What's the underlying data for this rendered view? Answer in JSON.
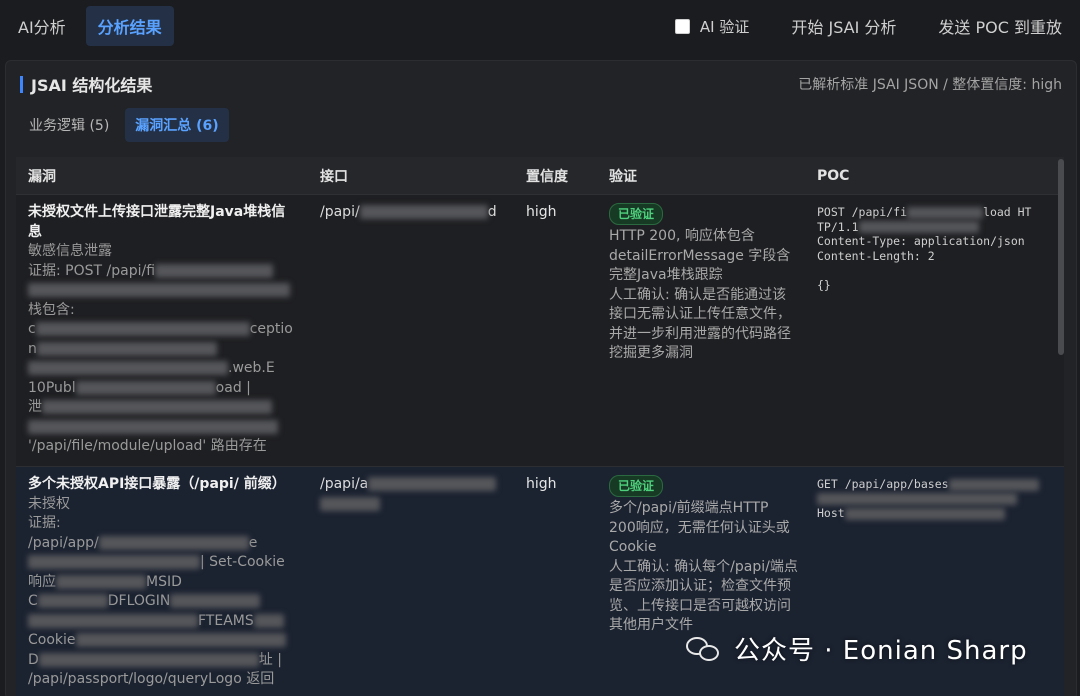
{
  "topbar": {
    "tabs": [
      {
        "label": "AI分析",
        "active": false
      },
      {
        "label": "分析结果",
        "active": true
      }
    ],
    "ai_verify_label": "AI 验证",
    "ai_verify_checked": false,
    "start_label": "开始 JSAI 分析",
    "send_poc_label": "发送 POC 到重放"
  },
  "panel": {
    "title": "JSAI 结构化结果",
    "meta": "已解析标准 JSAI JSON / 整体置信度: high",
    "subtabs": [
      {
        "label": "业务逻辑 (5)",
        "active": false
      },
      {
        "label": "漏洞汇总 (6)",
        "active": true
      }
    ]
  },
  "table": {
    "headers": [
      "漏洞",
      "接口",
      "置信度",
      "验证",
      "POC"
    ],
    "rows": [
      {
        "title": "未授权文件上传接口泄露完整Java堆栈信息",
        "category": "敏感信息泄露",
        "evidence_prefix": "证据: POST /papi/fi",
        "evidence_l2": "栈包含:",
        "evidence_l3": "c",
        "evidence_l3b": "ceptio",
        "evidence_l4": "n",
        "evidence_l5": ".web.E",
        "evidence_l6": "10Publ",
        "evidence_l6b": "oad |",
        "evidence_l7": "泄",
        "evidence_last": "'/papi/file/module/upload' 路由存在",
        "api": "/papi/",
        "api_tail": "d",
        "confidence": "high",
        "badge": "已验证",
        "verify": "HTTP 200, 响应体包含 detailErrorMessage 字段含完整Java堆栈跟踪\n人工确认: 确认是否能通过该接口无需认证上传任意文件，并进一步利用泄露的代码路径挖掘更多漏洞",
        "poc_l1": "POST /papi/fi",
        "poc_l1b": "load HT",
        "poc_l2": "TP/1.1",
        "poc_l3": "Content-Type: application/json",
        "poc_l4": "Content-Length: 2",
        "poc_l5": "{}"
      },
      {
        "title": "多个未授权API接口暴露（/papi/ 前缀）",
        "category": "未授权",
        "evidence_prefix": "证据:",
        "evidence_l2": "/papi/app/",
        "evidence_l2b": "e",
        "evidence_l3b": "| Set-Cookie",
        "evidence_l4": "响应",
        "evidence_l4b": "MSID",
        "evidence_l5": "C",
        "evidence_l5b": "DFLOGIN",
        "evidence_l6b": "FTEAMS",
        "evidence_l7": "Cookie",
        "evidence_l8": "D",
        "evidence_l8b": "址 |",
        "evidence_l9": "/papi/passport/logo/queryLogo 返回",
        "api": "/papi/a",
        "confidence": "high",
        "badge": "已验证",
        "verify": "多个/papi/前缀端点HTTP 200响应，无需任何认证头或Cookie\n人工确认: 确认每个/papi/端点是否应添加认证；检查文件预览、上传接口是否可越权访问其他用户文件",
        "poc_l1": "GET /papi/app/bases",
        "poc_l2": "Host"
      }
    ]
  },
  "watermark": {
    "text": "公众号 · Eonian Sharp",
    "icon": "wechat-icon"
  }
}
